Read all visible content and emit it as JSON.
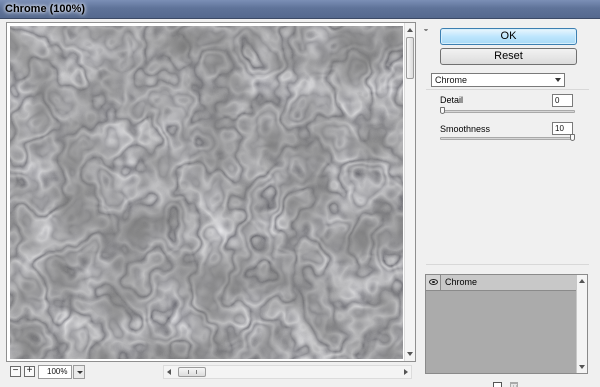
{
  "window": {
    "title": "Chrome (100%)"
  },
  "preview": {
    "zoom_level": "100%",
    "zoom_out_label": "−",
    "zoom_in_label": "+",
    "effect": "chrome"
  },
  "actions": {
    "ok_label": "OK",
    "reset_label": "Reset"
  },
  "filter": {
    "selected": "Chrome",
    "params": [
      {
        "label": "Detail",
        "value": "0",
        "level_fraction": 0.0
      },
      {
        "label": "Smoothness",
        "value": "10",
        "level_fraction": 1.0
      }
    ]
  },
  "effect_layers": {
    "items": [
      {
        "name": "Chrome",
        "visible": true
      }
    ]
  },
  "icons": {
    "collapse": "double-chevron-up-icon",
    "eye": "eye-icon",
    "new_layer": "new-effect-layer-icon",
    "delete": "trash-icon"
  },
  "colors": {
    "ok_button": "#bee6fd",
    "title_bar": "#5f7399",
    "layers_bg": "#ababab"
  }
}
